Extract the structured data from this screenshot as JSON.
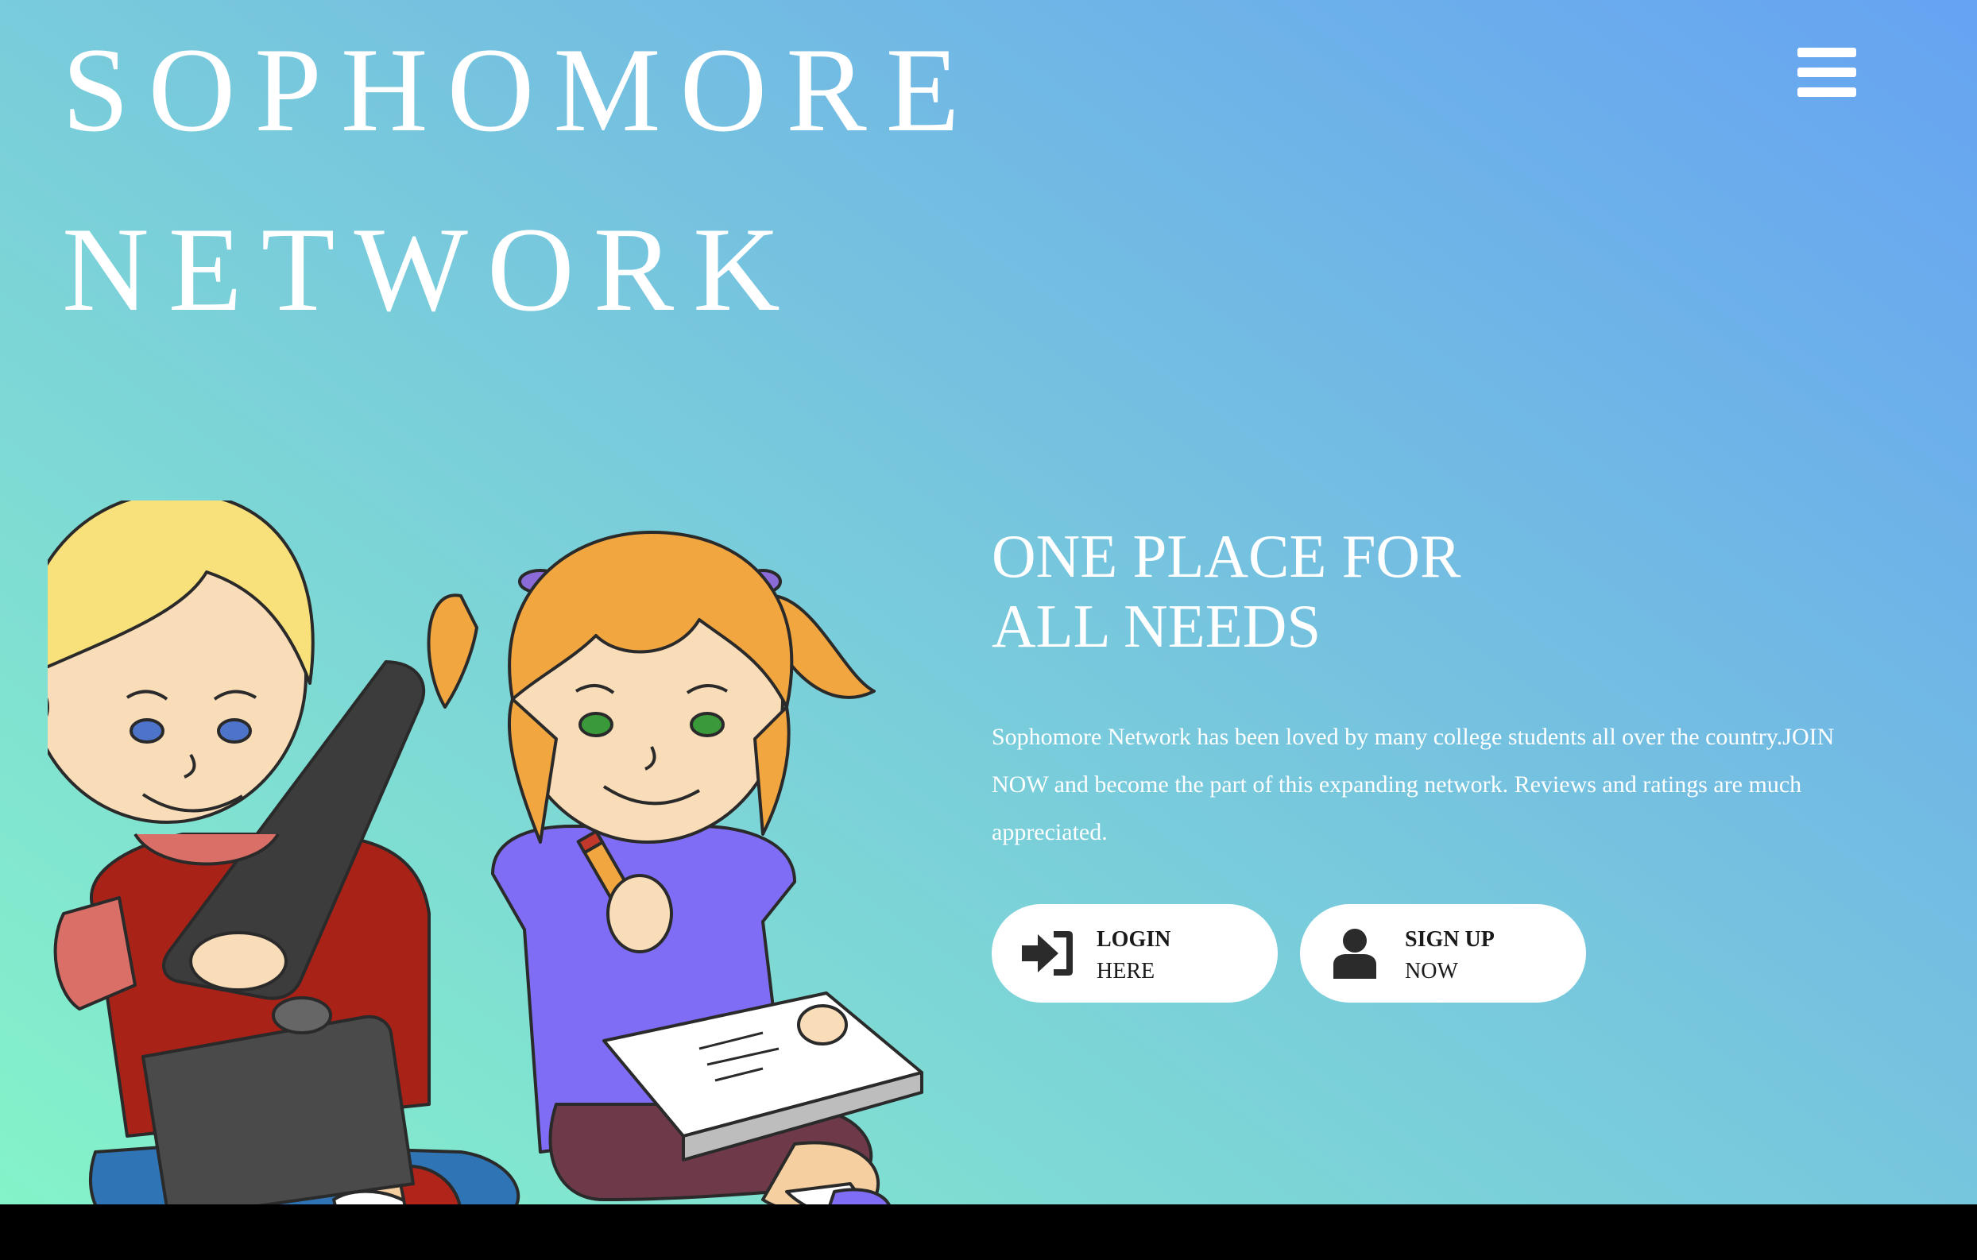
{
  "brand": {
    "line1": "SOPHOMORE",
    "line2": "NETWORK"
  },
  "nav": {
    "menu_icon": "hamburger-menu-icon"
  },
  "hero": {
    "title_line1": "ONE PLACE FOR",
    "title_line2": "ALL NEEDS",
    "description": "Sophomore Network has been loved by many college students all over the country.JOIN NOW and become the part of this expanding network. Reviews and ratings are much appreciated."
  },
  "buttons": {
    "login": {
      "label": "LOGIN",
      "sublabel": "HERE",
      "icon": "sign-in-icon"
    },
    "signup": {
      "label": "SIGN UP",
      "sublabel": "NOW",
      "icon": "user-icon"
    }
  },
  "illustration": {
    "subject": "kids-studying-illustration"
  },
  "colors": {
    "gradient_start": "#85f5c8",
    "gradient_end": "#66a3f2",
    "text": "#ffffff",
    "button_bg": "#ffffff",
    "button_text": "#1a1a1a",
    "footer_bar": "#000000"
  }
}
